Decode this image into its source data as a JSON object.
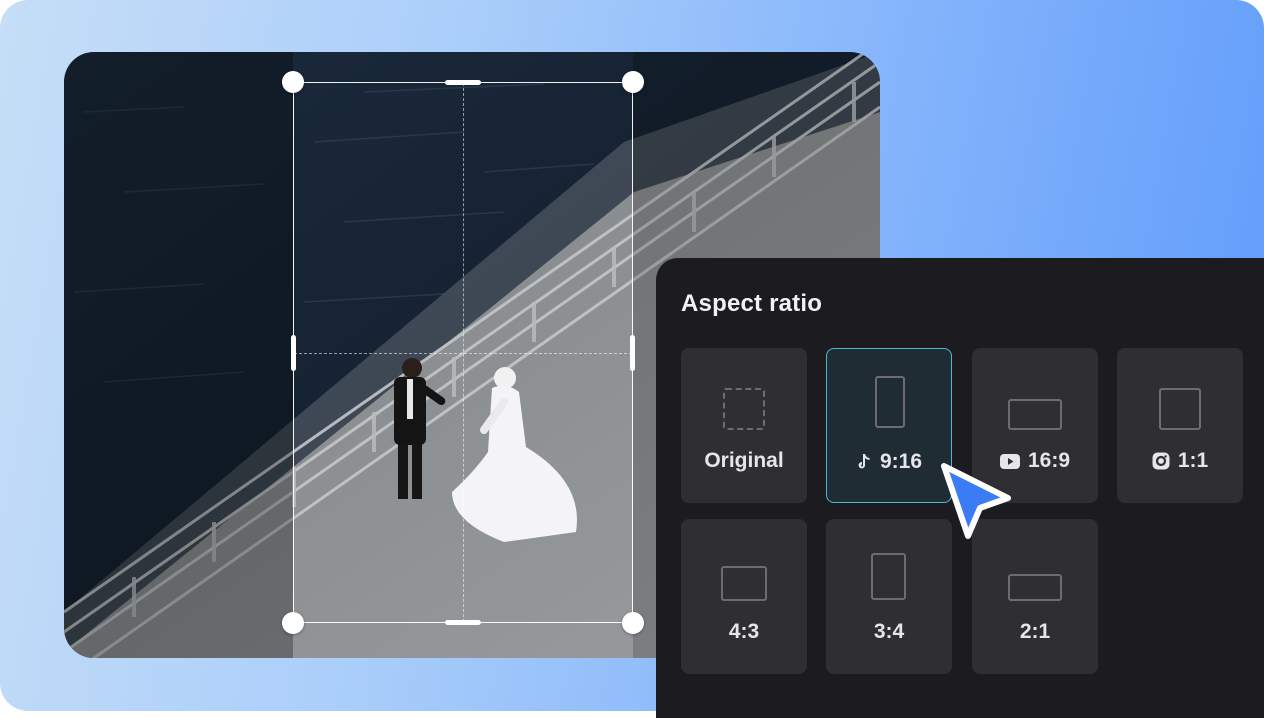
{
  "panel": {
    "title": "Aspect ratio",
    "options": [
      {
        "label": "Original",
        "icon": "dashed-square-icon"
      },
      {
        "label": "9:16",
        "icon": "tiktok-icon",
        "selected": true
      },
      {
        "label": "16:9",
        "icon": "youtube-icon"
      },
      {
        "label": "1:1",
        "icon": "instagram-icon"
      },
      {
        "label": "4:3",
        "icon": ""
      },
      {
        "label": "3:4",
        "icon": ""
      },
      {
        "label": "2:1",
        "icon": ""
      }
    ]
  },
  "colors": {
    "background_gradient_start": "#c6def7",
    "background_gradient_end": "#5f9bfb",
    "panel_background": "#1c1c20",
    "tile_background": "#2f2f33",
    "selected_border": "#4fb7d6",
    "cursor": "#3b7cf5"
  }
}
